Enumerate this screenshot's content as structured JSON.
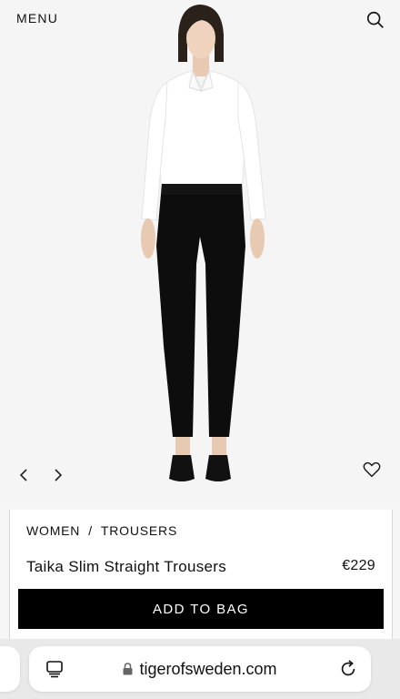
{
  "header": {
    "menu_label": "MENU",
    "search_icon": "search-icon"
  },
  "gallery": {
    "prev_icon": "chevron-left-icon",
    "next_icon": "chevron-right-icon",
    "wishlist_icon": "heart-icon"
  },
  "product": {
    "breadcrumb": [
      "WOMEN",
      "/",
      "TROUSERS"
    ],
    "name": "Taika Slim Straight Trousers",
    "price": "€229",
    "add_label": "ADD TO BAG"
  },
  "browser": {
    "url": "tigerofsweden.com",
    "tabs_icon": "tabs-icon",
    "lock_icon": "lock-icon",
    "reload_icon": "reload-icon"
  },
  "colors": {
    "button_bg": "#000000",
    "button_text": "#ffffff",
    "page_bg": "#f5f5f5"
  }
}
